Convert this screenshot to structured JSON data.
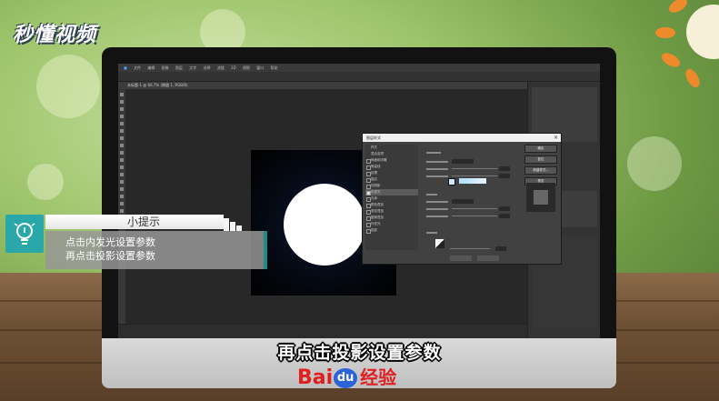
{
  "watermark": {
    "logo_text": "秒懂视频"
  },
  "photoshop": {
    "menu_items": [
      "文件",
      "编辑",
      "图像",
      "图层",
      "文字",
      "选择",
      "滤镜",
      "3D",
      "视图",
      "窗口",
      "帮助"
    ],
    "document_tab": "未标题-1 @ 66.7% (椭圆 1, RGB/8)",
    "dialog": {
      "title": "图层样式",
      "close_glyph": "×",
      "style_list": [
        "样式",
        "混合选项",
        "斜面和浮雕",
        "等高线",
        "纹理",
        "描边",
        "内阴影",
        "内发光",
        "光泽",
        "颜色叠加",
        "渐变叠加",
        "图案叠加",
        "外发光",
        "投影"
      ],
      "selected_style": "内发光",
      "buttons": [
        "确定",
        "复位",
        "新建样式...",
        "预览"
      ]
    }
  },
  "tip": {
    "title": "小提示",
    "lines": [
      "点击内发光设置参数",
      "再点击投影设置参数"
    ],
    "icon": "lightbulb-icon"
  },
  "subtitle": "再点击投影设置参数",
  "brand": {
    "bai": "Bai",
    "du": "du",
    "suffix": "经验"
  },
  "colors": {
    "accent": "#2aa7a8",
    "brand_red": "#e02020",
    "brand_blue": "#2b63d9"
  }
}
